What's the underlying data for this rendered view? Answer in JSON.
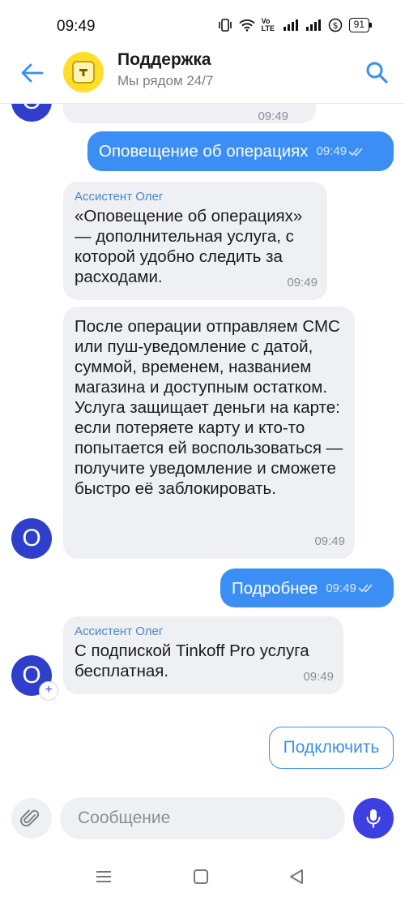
{
  "status_bar": {
    "time": "09:49",
    "battery": "91",
    "network_label": "Vo LTE"
  },
  "header": {
    "title": "Поддержка",
    "subtitle": "Мы рядом 24/7",
    "back_icon": "arrow-left-icon",
    "search_icon": "search-icon"
  },
  "messages": [
    {
      "type": "incoming-cut",
      "time": "09:49"
    },
    {
      "type": "outgoing",
      "text": "Оповещение об операциях",
      "time": "09:49"
    },
    {
      "type": "incoming",
      "sender": "Ассистент Олег",
      "text": "«Оповещение об операциях» — дополнительная услуга, с которой удобно следить за расходами.",
      "time": "09:49"
    },
    {
      "type": "incoming",
      "text": "После операции отправляем СМС или пуш-уведомление с датой, суммой, временем, названием магазина и доступным остатком. Услуга защищает деньги на карте: если потеряете карту и кто-то попытается ей воспользоваться — получите уведомление и сможете быстро её заблокировать.",
      "time": "09:49"
    },
    {
      "type": "outgoing",
      "text": "Подробнее",
      "time": "09:49"
    },
    {
      "type": "incoming",
      "sender": "Ассистент Олег",
      "text": "С подпиской Tinkoff Pro услуга бесплатная.",
      "time": "09:49"
    }
  ],
  "avatar_letter": "O",
  "plus_badge": "+",
  "quick_reply": "Подключить",
  "composer": {
    "placeholder": "Сообщение"
  },
  "colors": {
    "accent": "#3b8ef3",
    "avatar": "#2f3fcb",
    "mic": "#3d3fe0",
    "incoming_bubble": "#eef0f3",
    "logo": "#ffdd2d"
  }
}
